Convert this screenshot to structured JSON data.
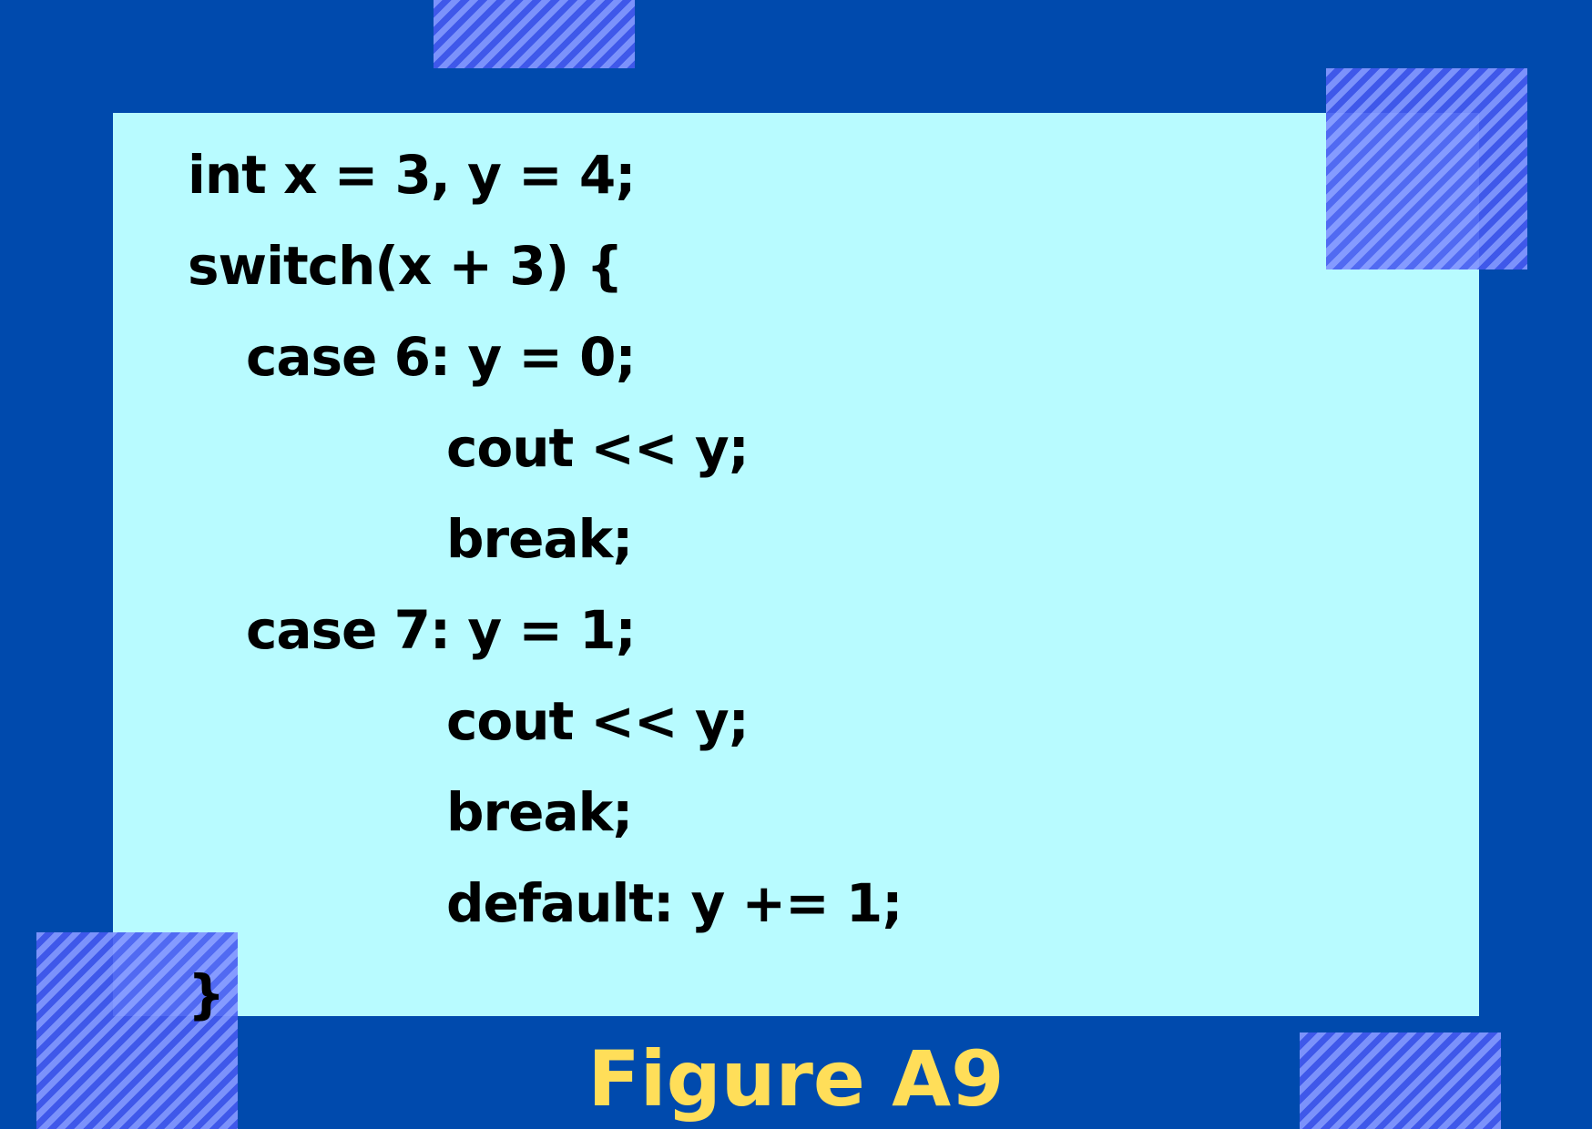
{
  "code": {
    "lines": [
      "int x = 3, y = 4;",
      "switch(x + 3) {",
      "case 6: y = 0;",
      "cout << y;",
      "break;",
      "case 7: y = 1;",
      "cout << y;",
      "break;",
      "default: y += 1;",
      "}"
    ]
  },
  "caption": "Figure A9",
  "colors": {
    "background": "#004aad",
    "panel": "#b8fbff",
    "caption": "#ffde59",
    "text": "#000000"
  }
}
